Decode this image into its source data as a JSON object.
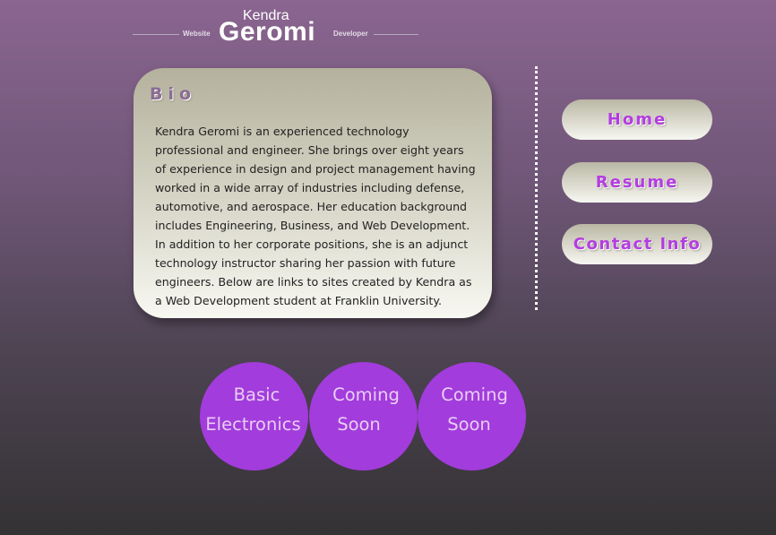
{
  "header": {
    "first_name": "Kendra",
    "last_name": "Geromi",
    "tagline_left": "Website",
    "tagline_right": "Developer"
  },
  "bio": {
    "title": "Bio",
    "text": "Kendra Geromi is an experienced technology professional and engineer. She brings over eight years of experience in design and project management having worked in a wide array of industries including defense, automotive, and aerospace. Her education background includes Engineering, Business, and Web Development. In addition to her corporate positions, she is an adjunct technology instructor sharing her passion with future engineers. Below are links to sites created by Kendra as a Web Development student at Franklin University."
  },
  "nav": {
    "items": [
      {
        "label": "Home"
      },
      {
        "label": "Resume"
      },
      {
        "label": "Contact Info"
      }
    ]
  },
  "projects": [
    {
      "line1": "Basic",
      "line2": "Electronics"
    },
    {
      "line1": "Coming",
      "line2": "Soon"
    },
    {
      "line1": "Coming",
      "line2": "Soon"
    }
  ],
  "colors": {
    "accent": "#a23cdc",
    "nav_text": "#b33de0",
    "background_top": "#8a6590",
    "background_bottom": "#343234"
  }
}
